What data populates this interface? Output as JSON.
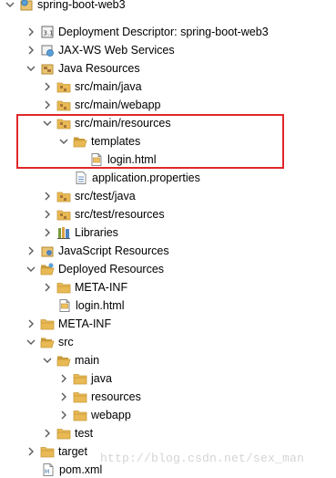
{
  "tree": {
    "nodes": [
      {
        "label": "spring-boot-web3",
        "icon": "web-project-icon",
        "state": "expanded"
      },
      {
        "label": "Deployment Descriptor: spring-boot-web3",
        "icon": "deployment-descriptor-icon",
        "state": "collapsed"
      },
      {
        "label": "JAX-WS Web Services",
        "icon": "web-services-icon",
        "state": "collapsed"
      },
      {
        "label": "Java Resources",
        "icon": "java-resources-icon",
        "state": "expanded"
      },
      {
        "label": "src/main/java",
        "icon": "source-folder-icon",
        "state": "collapsed"
      },
      {
        "label": "src/main/webapp",
        "icon": "source-folder-icon",
        "state": "collapsed"
      },
      {
        "label": "src/main/resources",
        "icon": "source-folder-icon",
        "state": "expanded"
      },
      {
        "label": "templates",
        "icon": "folder-open-icon",
        "state": "expanded"
      },
      {
        "label": "login.html",
        "icon": "html-file-icon",
        "state": "leaf"
      },
      {
        "label": "application.properties",
        "icon": "properties-file-icon",
        "state": "leaf"
      },
      {
        "label": "src/test/java",
        "icon": "source-folder-icon",
        "state": "collapsed"
      },
      {
        "label": "src/test/resources",
        "icon": "source-folder-icon",
        "state": "collapsed"
      },
      {
        "label": "Libraries",
        "icon": "libraries-icon",
        "state": "collapsed"
      },
      {
        "label": "JavaScript Resources",
        "icon": "javascript-resources-icon",
        "state": "collapsed"
      },
      {
        "label": "Deployed Resources",
        "icon": "deployed-resources-icon",
        "state": "expanded"
      },
      {
        "label": "META-INF",
        "icon": "folder-icon",
        "state": "collapsed"
      },
      {
        "label": "login.html",
        "icon": "html-file-icon",
        "state": "leaf"
      },
      {
        "label": "META-INF",
        "icon": "folder-icon",
        "state": "collapsed"
      },
      {
        "label": "src",
        "icon": "folder-open-icon",
        "state": "expanded"
      },
      {
        "label": "main",
        "icon": "folder-open-icon",
        "state": "expanded"
      },
      {
        "label": "java",
        "icon": "folder-icon",
        "state": "collapsed"
      },
      {
        "label": "resources",
        "icon": "folder-icon",
        "state": "collapsed"
      },
      {
        "label": "webapp",
        "icon": "folder-icon",
        "state": "collapsed"
      },
      {
        "label": "test",
        "icon": "folder-icon",
        "state": "collapsed"
      },
      {
        "label": "target",
        "icon": "folder-icon",
        "state": "collapsed"
      },
      {
        "label": "pom.xml",
        "icon": "xml-file-icon",
        "state": "leaf"
      }
    ]
  },
  "watermark": {
    "text": "http://blog.csdn.net/sex_man"
  },
  "colors": {
    "highlight_border": "#e0262a",
    "folder": "#e8b954",
    "folder_dark": "#c99a3a",
    "package_brown": "#a7743a",
    "twisty": "#595959"
  }
}
